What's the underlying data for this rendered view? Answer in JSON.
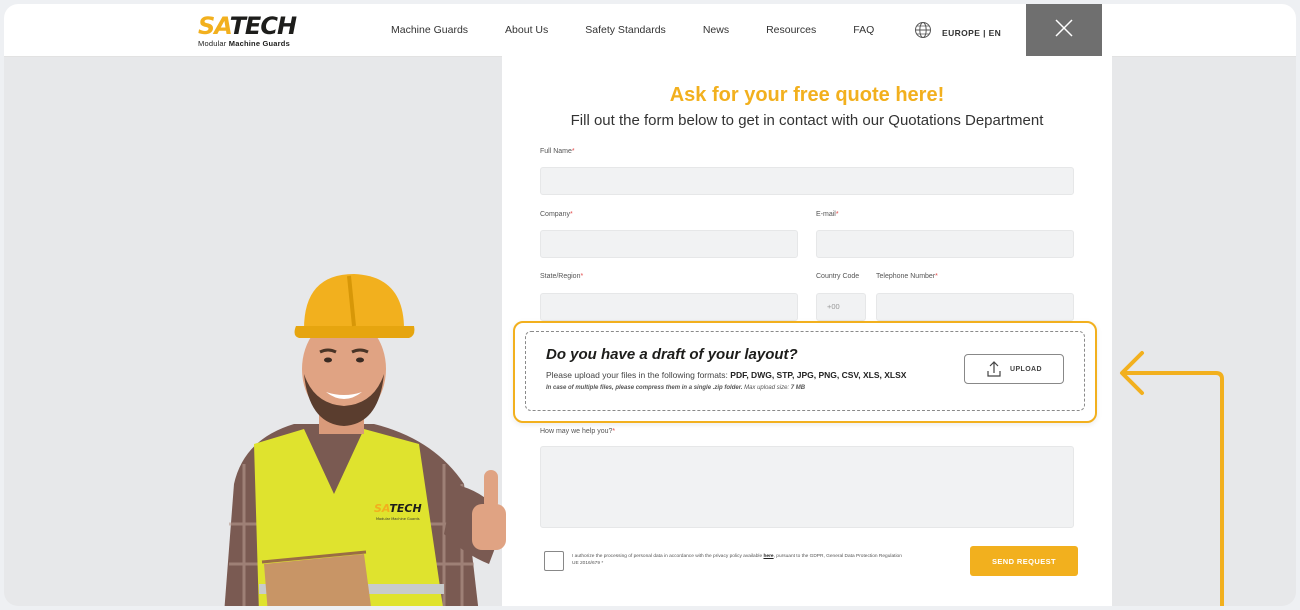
{
  "logo": {
    "sa": "SA",
    "tech": "TECH",
    "sub_prefix": "Modular",
    "sub_bold": "Machine Guards"
  },
  "nav": {
    "items": [
      "Machine Guards",
      "About Us",
      "Safety Standards",
      "News",
      "Resources",
      "FAQ"
    ],
    "region": "EUROPE",
    "separator": "|",
    "language": "EN"
  },
  "form": {
    "title": "Ask for your free quote here!",
    "subtitle": "Fill out the form below to get in contact with our Quotations Department",
    "labels": {
      "full_name": "Full Name",
      "company": "Company",
      "email": "E-mail",
      "state": "State/Region",
      "country_code": "Country Code",
      "phone": "Telephone Number",
      "help": "How may we help you?"
    },
    "required_mark": "*",
    "country_code_placeholder": "+00",
    "upload": {
      "title": "Do you have a draft of your layout?",
      "formats_prefix": "Please upload your files in the following formats:",
      "formats": "PDF, DWG, STP, JPG, PNG, CSV, XLS, XLSX",
      "note": "In case of multiple files, please compress them in a single .zip folder.",
      "max_prefix": "Max upload size:",
      "max_value": "7 MB",
      "button": "UPLOAD"
    },
    "consent": {
      "prefix": "I authorize the processing of personal data in accordance with the privacy policy available",
      "link": "here",
      "suffix": ", pursuant to the GDPR, General Data Protection Regulation UE 2016/679"
    },
    "send": "SEND REQUEST"
  },
  "person": {
    "vest_logo_sa": "SA",
    "vest_logo_tech": "TECH",
    "vest_logo_sub": "Modular Machine Guards"
  },
  "colors": {
    "accent": "#f2b01e",
    "close_bg": "#6f6f6f",
    "field_bg": "#f1f2f3"
  },
  "icons": {
    "globe": "globe-icon",
    "close": "close-icon",
    "upload": "upload-icon",
    "arrow": "arrow-left-icon"
  }
}
